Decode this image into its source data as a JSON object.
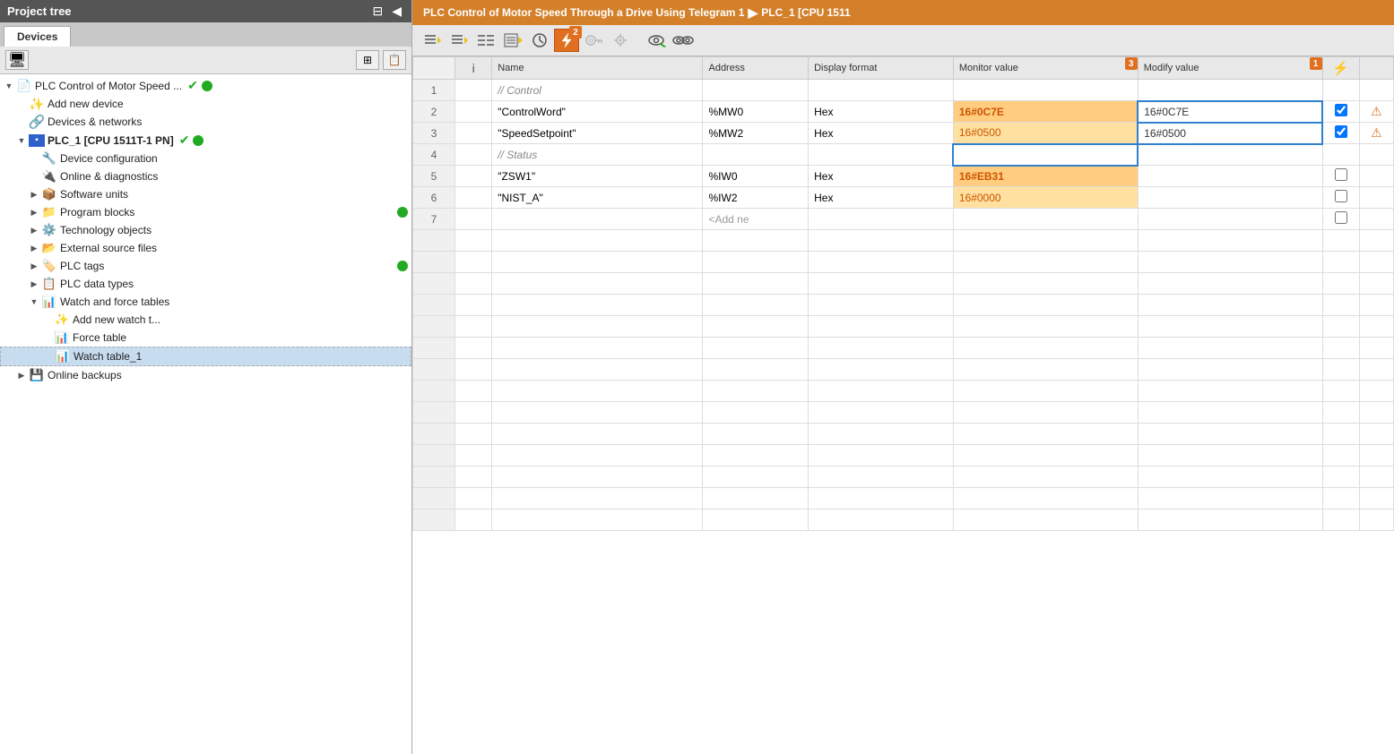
{
  "sidebar": {
    "title": "Project tree",
    "tab": "Devices",
    "items": [
      {
        "id": "plc-project",
        "label": "PLC Control of Motor Speed ...",
        "indent": 0,
        "arrow": "▼",
        "icon": "📄",
        "hasCheck": true,
        "hasDot": true,
        "dotColor": "#22aa22"
      },
      {
        "id": "add-device",
        "label": "Add new device",
        "indent": 1,
        "arrow": "",
        "icon": "✨",
        "hasCheck": false,
        "hasDot": false
      },
      {
        "id": "devices-networks",
        "label": "Devices & networks",
        "indent": 1,
        "arrow": "",
        "icon": "🔗",
        "hasCheck": false,
        "hasDot": false
      },
      {
        "id": "plc1",
        "label": "PLC_1 [CPU 1511T-1 PN]",
        "indent": 1,
        "arrow": "▼",
        "icon": "🟦",
        "hasCheck": true,
        "hasDot": true,
        "dotColor": "#22aa22"
      },
      {
        "id": "device-config",
        "label": "Device configuration",
        "indent": 2,
        "arrow": "",
        "icon": "🔧",
        "hasCheck": false,
        "hasDot": false
      },
      {
        "id": "online-diag",
        "label": "Online & diagnostics",
        "indent": 2,
        "arrow": "",
        "icon": "🔌",
        "hasCheck": false,
        "hasDot": false
      },
      {
        "id": "software-units",
        "label": "Software units",
        "indent": 2,
        "arrow": "▶",
        "icon": "📦",
        "hasCheck": false,
        "hasDot": false
      },
      {
        "id": "program-blocks",
        "label": "Program blocks",
        "indent": 2,
        "arrow": "▶",
        "icon": "📁",
        "hasCheck": false,
        "hasDot": true,
        "dotColor": "#22aa22"
      },
      {
        "id": "tech-objects",
        "label": "Technology objects",
        "indent": 2,
        "arrow": "▶",
        "icon": "⚙️",
        "hasCheck": false,
        "hasDot": false
      },
      {
        "id": "ext-source",
        "label": "External source files",
        "indent": 2,
        "arrow": "▶",
        "icon": "📂",
        "hasCheck": false,
        "hasDot": false
      },
      {
        "id": "plc-tags",
        "label": "PLC tags",
        "indent": 2,
        "arrow": "▶",
        "icon": "🏷️",
        "hasCheck": false,
        "hasDot": true,
        "dotColor": "#22aa22"
      },
      {
        "id": "plc-data-types",
        "label": "PLC data types",
        "indent": 2,
        "arrow": "▶",
        "icon": "📋",
        "hasCheck": false,
        "hasDot": false
      },
      {
        "id": "watch-force",
        "label": "Watch and force tables",
        "indent": 2,
        "arrow": "▼",
        "icon": "📊",
        "hasCheck": false,
        "hasDot": false
      },
      {
        "id": "add-watch",
        "label": "Add new watch t...",
        "indent": 3,
        "arrow": "",
        "icon": "✨",
        "hasCheck": false,
        "hasDot": false
      },
      {
        "id": "force-table",
        "label": "Force table",
        "indent": 3,
        "arrow": "",
        "icon": "📊",
        "hasCheck": false,
        "hasDot": false
      },
      {
        "id": "watch-table1",
        "label": "Watch table_1",
        "indent": 3,
        "arrow": "",
        "icon": "📊",
        "hasCheck": false,
        "hasDot": false,
        "selected": true
      },
      {
        "id": "online-backups",
        "label": "Online backups",
        "indent": 1,
        "arrow": "▶",
        "icon": "💾",
        "hasCheck": false,
        "hasDot": false
      }
    ]
  },
  "topbar": {
    "breadcrumb": "PLC Control of Motor Speed Through a Drive Using Telegram 1",
    "separator": "▶",
    "current": "PLC_1 [CPU 1511"
  },
  "toolbar": {
    "buttons": [
      {
        "id": "tb1",
        "icon": "≋⚡",
        "tooltip": "Monitor all",
        "active": false
      },
      {
        "id": "tb2",
        "icon": "≋⚡",
        "tooltip": "Monitor",
        "active": false
      },
      {
        "id": "tb3",
        "icon": "|||",
        "tooltip": "Separate",
        "active": false
      },
      {
        "id": "tb4",
        "icon": "📋⚡",
        "tooltip": "Force",
        "active": false
      },
      {
        "id": "tb5",
        "icon": "⏱",
        "tooltip": "Trigger",
        "active": false
      },
      {
        "id": "tb6",
        "icon": "⚡",
        "tooltip": "Show all",
        "active": true,
        "badge": "2"
      },
      {
        "id": "tb7",
        "icon": "🔑",
        "tooltip": "Keys",
        "active": false
      },
      {
        "id": "tb8",
        "icon": "🔧",
        "tooltip": "Settings",
        "active": false
      },
      {
        "id": "tb9",
        "icon": "👁",
        "tooltip": "View1",
        "active": false
      },
      {
        "id": "tb10",
        "icon": "👁👁",
        "tooltip": "View2",
        "active": false
      }
    ]
  },
  "table": {
    "columns": [
      {
        "id": "num",
        "label": "",
        "class": "col-num"
      },
      {
        "id": "i",
        "label": "i",
        "class": "col-i"
      },
      {
        "id": "name",
        "label": "Name",
        "class": "col-name"
      },
      {
        "id": "address",
        "label": "Address",
        "class": "col-address"
      },
      {
        "id": "format",
        "label": "Display format",
        "class": "col-format"
      },
      {
        "id": "monitor",
        "label": "Monitor value",
        "class": "col-monitor",
        "badge": "3"
      },
      {
        "id": "modify",
        "label": "Modify value",
        "class": "col-modify",
        "badge": "1"
      },
      {
        "id": "check",
        "label": "⚡",
        "class": "col-check"
      },
      {
        "id": "warn",
        "label": "",
        "class": "col-warn"
      }
    ],
    "rows": [
      {
        "num": "1",
        "i": "",
        "name": "// Control",
        "address": "",
        "format": "",
        "monitor": "",
        "modify": "",
        "isSection": true,
        "check": false,
        "warn": false
      },
      {
        "num": "2",
        "i": "",
        "name": "\"ControlWord\"",
        "address": "%MW0",
        "format": "Hex",
        "monitor": "16#0C7E",
        "modify": "16#0C7E",
        "isSection": false,
        "monitorClass": "value-orange",
        "modifyClass": "value-edit",
        "check": true,
        "warn": true
      },
      {
        "num": "3",
        "i": "",
        "name": "\"SpeedSetpoint\"",
        "address": "%MW2",
        "format": "Hex",
        "monitor": "16#0500",
        "modify": "16#0500",
        "isSection": false,
        "monitorClass": "value-orange-light",
        "modifyClass": "value-edit",
        "check": true,
        "warn": true
      },
      {
        "num": "4",
        "i": "",
        "name": "// Status",
        "address": "",
        "format": "",
        "monitor": "",
        "modify": "",
        "isSection": true,
        "check": false,
        "warn": false
      },
      {
        "num": "5",
        "i": "",
        "name": "\"ZSW1\"",
        "address": "%IW0",
        "format": "Hex",
        "monitor": "16#EB31",
        "modify": "",
        "isSection": false,
        "monitorClass": "value-orange",
        "modifyClass": "",
        "check": false,
        "warn": false
      },
      {
        "num": "6",
        "i": "",
        "name": "\"NIST_A\"",
        "address": "%IW2",
        "format": "Hex",
        "monitor": "16#0000",
        "modify": "",
        "isSection": false,
        "monitorClass": "value-orange-light",
        "modifyClass": "",
        "check": false,
        "warn": false
      },
      {
        "num": "7",
        "i": "",
        "name": "",
        "address": "<Add ne",
        "format": "",
        "monitor": "",
        "modify": "",
        "isSection": false,
        "isAddNew": true,
        "check": false,
        "warn": false
      }
    ]
  },
  "icons": {
    "tree_expand": "▼",
    "tree_collapse": "▶",
    "project_icon": "📄",
    "add_device_icon": "✨",
    "devices_icon": "🔗",
    "plc_icon": "▪",
    "lightning": "⚡",
    "warning": "⚠"
  }
}
